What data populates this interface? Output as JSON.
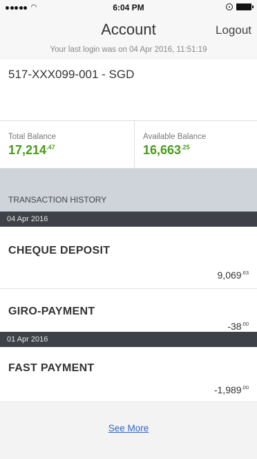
{
  "status_bar": {
    "signal_dots": 5,
    "wifi_icon": "wifi-icon",
    "time": "6:04 PM",
    "lock_icon": "rotation-lock-icon",
    "battery_icon": "battery-icon"
  },
  "header": {
    "title": "Account",
    "logout_label": "Logout",
    "last_login": "Your last login was on 04 Apr 2016, 11:51:19"
  },
  "account": {
    "number": "517-XXX099-001 - SGD"
  },
  "balances": {
    "total_label": "Total Balance",
    "total_whole": "17,214",
    "total_cents": ".47",
    "available_label": "Available Balance",
    "available_whole": "16,663",
    "available_cents": ".25",
    "value_color": "#4a9a1f"
  },
  "history": {
    "header": "TRANSACTION HISTORY",
    "groups": [
      {
        "date": "04 Apr 2016",
        "transactions": [
          {
            "name": "CHEQUE DEPOSIT",
            "amount_whole": "9,069",
            "amount_cents": ".63"
          },
          {
            "name": "GIRO-PAYMENT",
            "amount_whole": "-38",
            "amount_cents": ".00"
          }
        ]
      },
      {
        "date": "01 Apr 2016",
        "transactions": [
          {
            "name": "FAST PAYMENT",
            "amount_whole": "-1,989",
            "amount_cents": ".00"
          }
        ]
      }
    ]
  },
  "footer": {
    "see_more_label": "See More",
    "link_color": "#2d6ac2"
  }
}
